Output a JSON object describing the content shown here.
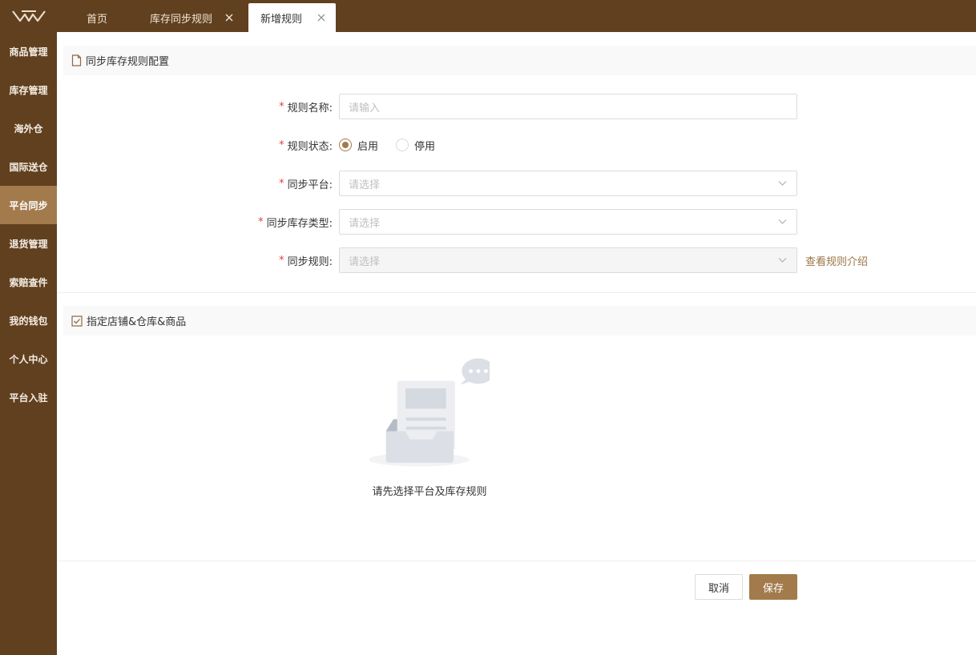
{
  "tabs": [
    {
      "label": "首页"
    },
    {
      "label": "库存同步规则"
    },
    {
      "label": "新增规则"
    }
  ],
  "sidebar": {
    "items": [
      {
        "label": "商品管理"
      },
      {
        "label": "库存管理"
      },
      {
        "label": "海外仓"
      },
      {
        "label": "国际送仓"
      },
      {
        "label": "平台同步"
      },
      {
        "label": "退货管理"
      },
      {
        "label": "索赔查件"
      },
      {
        "label": "我的钱包"
      },
      {
        "label": "个人中心"
      },
      {
        "label": "平台入驻"
      }
    ],
    "active_index": 4
  },
  "section1": {
    "title": "同步库存规则配置"
  },
  "form": {
    "required_mark": "*",
    "rule_name": {
      "label": "规则名称:",
      "placeholder": "请输入"
    },
    "rule_status": {
      "label": "规则状态:",
      "options": [
        "启用",
        "停用"
      ],
      "selected": "启用"
    },
    "sync_platform": {
      "label": "同步平台:",
      "placeholder": "请选择"
    },
    "sync_stock_type": {
      "label": "同步库存类型:",
      "placeholder": "请选择"
    },
    "sync_rule": {
      "label": "同步规则:",
      "placeholder": "请选择",
      "link": "查看规则介绍"
    }
  },
  "section2": {
    "title": "指定店铺&仓库&商品"
  },
  "empty_state": {
    "text": "请先选择平台及库存规则"
  },
  "actions": {
    "cancel": "取消",
    "save": "保存"
  },
  "colors": {
    "brand_dark": "#61401f",
    "accent": "#a27a4c",
    "required": "#e0433d"
  }
}
